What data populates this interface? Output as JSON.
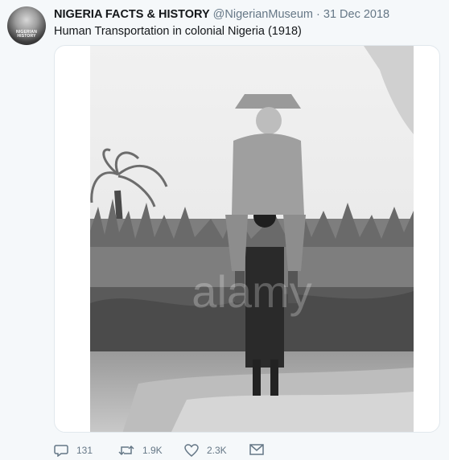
{
  "tweet": {
    "avatar_text": "NIGERIAN HISTORY",
    "display_name": "NIGERIA FACTS & HISTORY",
    "handle": "@NigerianMuseum",
    "separator": "·",
    "date": "31 Dec 2018",
    "text": "Human Transportation in colonial Nigeria (1918)"
  },
  "media": {
    "watermark": "alamy",
    "photo_icon": "historical-photo"
  },
  "actions": {
    "replies": "131",
    "retweets": "1.9K",
    "likes": "2.3K",
    "reply_icon": "reply-icon",
    "retweet_icon": "retweet-icon",
    "like_icon": "heart-icon",
    "dm_icon": "envelope-icon"
  },
  "colors": {
    "background": "#f5f8fa",
    "text": "#14171a",
    "secondary": "#657786",
    "border": "#e1e8ed"
  }
}
